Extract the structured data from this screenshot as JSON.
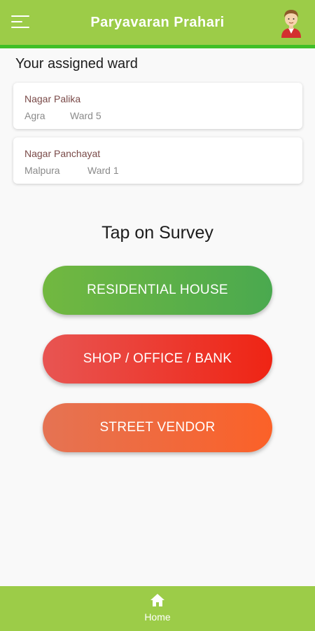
{
  "header": {
    "title": "Paryavaran Prahari",
    "menu_icon": "hamburger-menu-icon",
    "avatar_icon": "user-avatar-icon"
  },
  "assigned": {
    "title": "Your assigned ward",
    "wards": [
      {
        "type": "Nagar Palika",
        "city": "Agra",
        "ward": "Ward 5"
      },
      {
        "type": "Nagar Panchayat",
        "city": "Malpura",
        "ward": "Ward 1"
      }
    ]
  },
  "survey": {
    "prompt": "Tap on Survey",
    "buttons": [
      {
        "label": "RESIDENTIAL HOUSE",
        "color": "#5cb046"
      },
      {
        "label": "SHOP / OFFICE / BANK",
        "color": "#ec3b30"
      },
      {
        "label": "STREET VENDOR",
        "color": "#f16a3d"
      }
    ]
  },
  "bottom_nav": {
    "items": [
      {
        "label": "Home",
        "icon": "home-icon"
      }
    ]
  },
  "colors": {
    "header_bg": "#9ccc48",
    "header_stripe": "#3fbf27",
    "page_bg": "#f9f9f9"
  }
}
